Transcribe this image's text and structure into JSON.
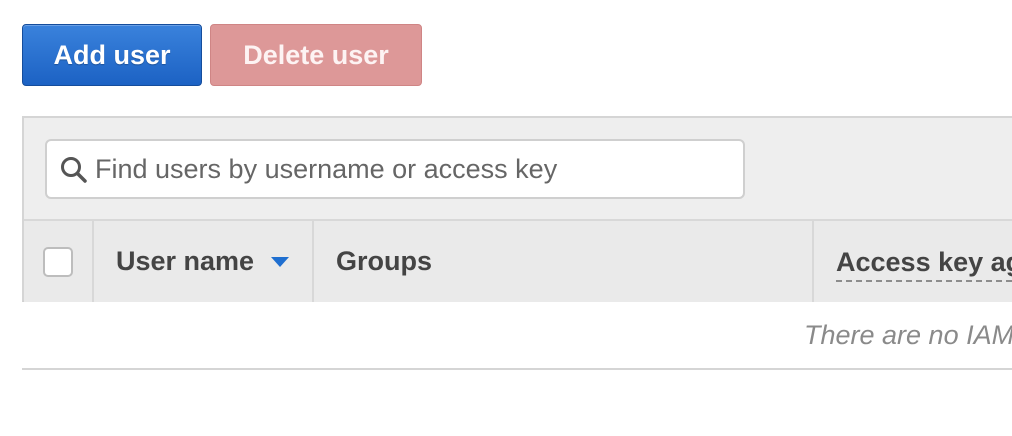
{
  "toolbar": {
    "add_user_label": "Add user",
    "delete_user_label": "Delete user"
  },
  "search": {
    "placeholder": "Find users by username or access key",
    "value": ""
  },
  "table": {
    "columns": {
      "user_name": "User name",
      "groups": "Groups",
      "access_key_age": "Access key ag"
    },
    "sort": {
      "column": "User name",
      "direction": "descending"
    },
    "empty_message": "There are no IAM"
  },
  "colors": {
    "primary_button": "#1c62c4",
    "disabled_danger_button": "#dd9898",
    "sort_arrow": "#1f6fd0"
  },
  "icons": {
    "search": "search-icon",
    "sort": "sort-down-icon"
  }
}
